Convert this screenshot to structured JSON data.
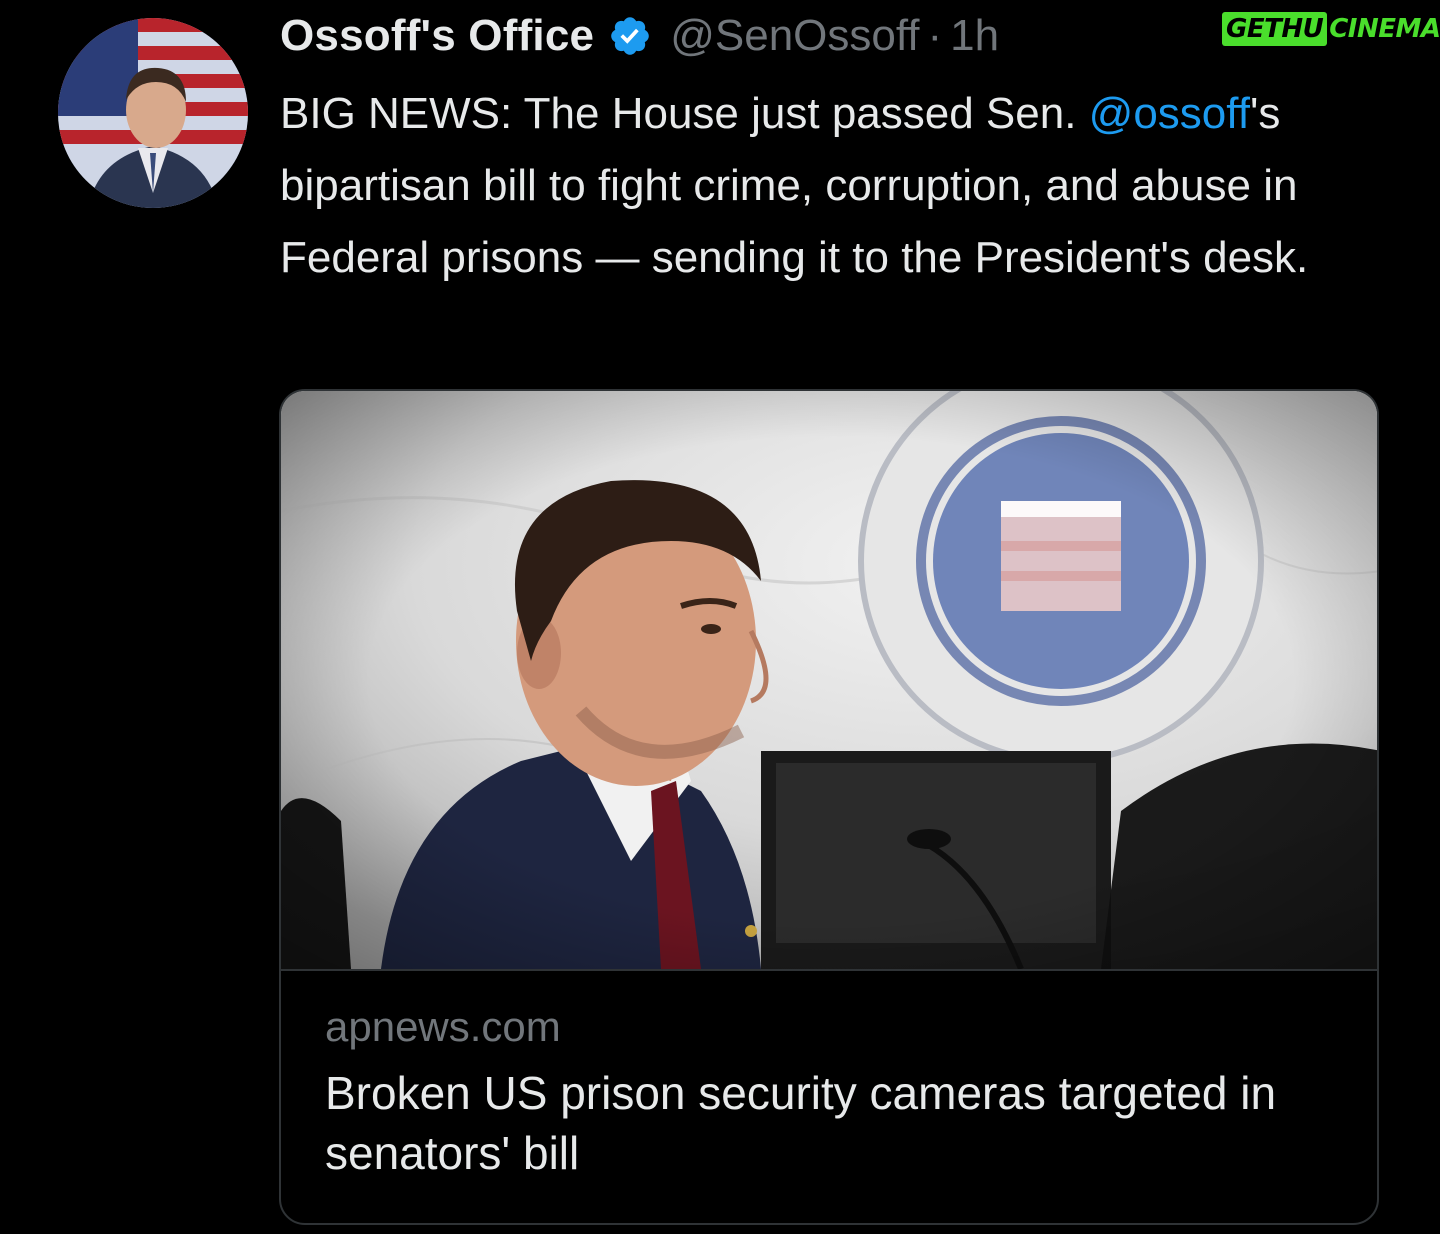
{
  "tweet": {
    "display_name": "Ossoff's Office",
    "verified_icon": "verified-badge-icon",
    "handle": "@SenOssoff",
    "separator": "·",
    "time": "1h",
    "text_part1": "BIG NEWS: The House just passed Sen. ",
    "mention": "@ossoff",
    "text_part2": "'s bipartisan bill to fight crime, corruption, and abuse in Federal prisons — sending it to the President's desk."
  },
  "card": {
    "domain": "apnews.com",
    "title": "Broken US prison security cameras targeted in senators' bill"
  },
  "watermark": {
    "part1": "GETHU",
    "part2": "CINEMA"
  },
  "colors": {
    "background": "#000000",
    "text": "#e7e9ea",
    "muted": "#71767b",
    "link": "#1d9bf0",
    "border": "#2f3336",
    "watermark": "#4ade2c"
  }
}
